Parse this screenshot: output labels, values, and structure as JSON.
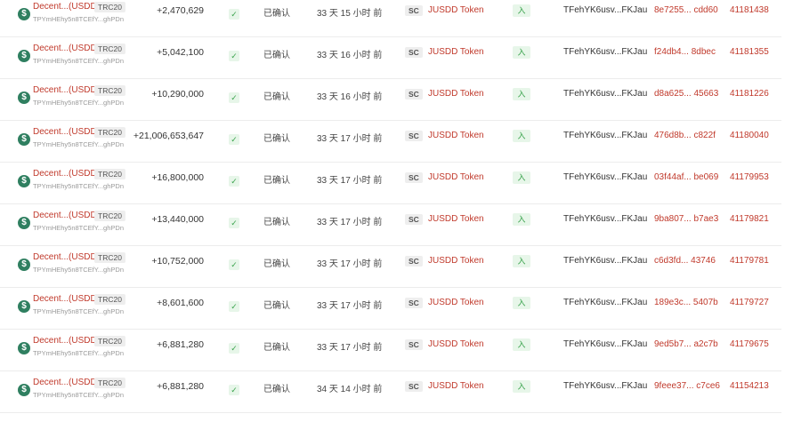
{
  "colors": {
    "accent_red": "#c0392b",
    "token_green": "#2f7f60",
    "success_green": "#3aa34d"
  },
  "icons": {
    "token": "usdd-coin-icon",
    "status": "checkmark-icon"
  },
  "rows": [
    {
      "token_name": "Decent...(USDD)",
      "standard": "TRC20",
      "token_address": "TPYmHEhy5n8TCEfY...ghPDn",
      "amount": "+2,470,629",
      "status": "已确认",
      "age": "33 天 15 小时 前",
      "contract_type": "SC",
      "contract_name": "JUSDD Token",
      "direction": "入",
      "from": "TFehYK6usv...FKJau",
      "hash": "8e7255... cdd60",
      "block": "41181438"
    },
    {
      "token_name": "Decent...(USDD)",
      "standard": "TRC20",
      "token_address": "TPYmHEhy5n8TCEfY...ghPDn",
      "amount": "+5,042,100",
      "status": "已确认",
      "age": "33 天 16 小时 前",
      "contract_type": "SC",
      "contract_name": "JUSDD Token",
      "direction": "入",
      "from": "TFehYK6usv...FKJau",
      "hash": "f24db4... 8dbec",
      "block": "41181355"
    },
    {
      "token_name": "Decent...(USDD)",
      "standard": "TRC20",
      "token_address": "TPYmHEhy5n8TCEfY...ghPDn",
      "amount": "+10,290,000",
      "status": "已确认",
      "age": "33 天 16 小时 前",
      "contract_type": "SC",
      "contract_name": "JUSDD Token",
      "direction": "入",
      "from": "TFehYK6usv...FKJau",
      "hash": "d8a625... 45663",
      "block": "41181226"
    },
    {
      "token_name": "Decent...(USDD)",
      "standard": "TRC20",
      "token_address": "TPYmHEhy5n8TCEfY...ghPDn",
      "amount": "+21,006,653,647",
      "status": "已确认",
      "age": "33 天 17 小时 前",
      "contract_type": "SC",
      "contract_name": "JUSDD Token",
      "direction": "入",
      "from": "TFehYK6usv...FKJau",
      "hash": "476d8b... c822f",
      "block": "41180040"
    },
    {
      "token_name": "Decent...(USDD)",
      "standard": "TRC20",
      "token_address": "TPYmHEhy5n8TCEfY...ghPDn",
      "amount": "+16,800,000",
      "status": "已确认",
      "age": "33 天 17 小时 前",
      "contract_type": "SC",
      "contract_name": "JUSDD Token",
      "direction": "入",
      "from": "TFehYK6usv...FKJau",
      "hash": "03f44af... be069",
      "block": "41179953"
    },
    {
      "token_name": "Decent...(USDD)",
      "standard": "TRC20",
      "token_address": "TPYmHEhy5n8TCEfY...ghPDn",
      "amount": "+13,440,000",
      "status": "已确认",
      "age": "33 天 17 小时 前",
      "contract_type": "SC",
      "contract_name": "JUSDD Token",
      "direction": "入",
      "from": "TFehYK6usv...FKJau",
      "hash": "9ba807... b7ae3",
      "block": "41179821"
    },
    {
      "token_name": "Decent...(USDD)",
      "standard": "TRC20",
      "token_address": "TPYmHEhy5n8TCEfY...ghPDn",
      "amount": "+10,752,000",
      "status": "已确认",
      "age": "33 天 17 小时 前",
      "contract_type": "SC",
      "contract_name": "JUSDD Token",
      "direction": "入",
      "from": "TFehYK6usv...FKJau",
      "hash": "c6d3fd... 43746",
      "block": "41179781"
    },
    {
      "token_name": "Decent...(USDD)",
      "standard": "TRC20",
      "token_address": "TPYmHEhy5n8TCEfY...ghPDn",
      "amount": "+8,601,600",
      "status": "已确认",
      "age": "33 天 17 小时 前",
      "contract_type": "SC",
      "contract_name": "JUSDD Token",
      "direction": "入",
      "from": "TFehYK6usv...FKJau",
      "hash": "189e3c... 5407b",
      "block": "41179727"
    },
    {
      "token_name": "Decent...(USDD)",
      "standard": "TRC20",
      "token_address": "TPYmHEhy5n8TCEfY...ghPDn",
      "amount": "+6,881,280",
      "status": "已确认",
      "age": "33 天 17 小时 前",
      "contract_type": "SC",
      "contract_name": "JUSDD Token",
      "direction": "入",
      "from": "TFehYK6usv...FKJau",
      "hash": "9ed5b7... a2c7b",
      "block": "41179675"
    },
    {
      "token_name": "Decent...(USDD)",
      "standard": "TRC20",
      "token_address": "TPYmHEhy5n8TCEfY...ghPDn",
      "amount": "+6,881,280",
      "status": "已确认",
      "age": "34 天 14 小时 前",
      "contract_type": "SC",
      "contract_name": "JUSDD Token",
      "direction": "入",
      "from": "TFehYK6usv...FKJau",
      "hash": "9feee37... c7ce6",
      "block": "41154213"
    }
  ]
}
